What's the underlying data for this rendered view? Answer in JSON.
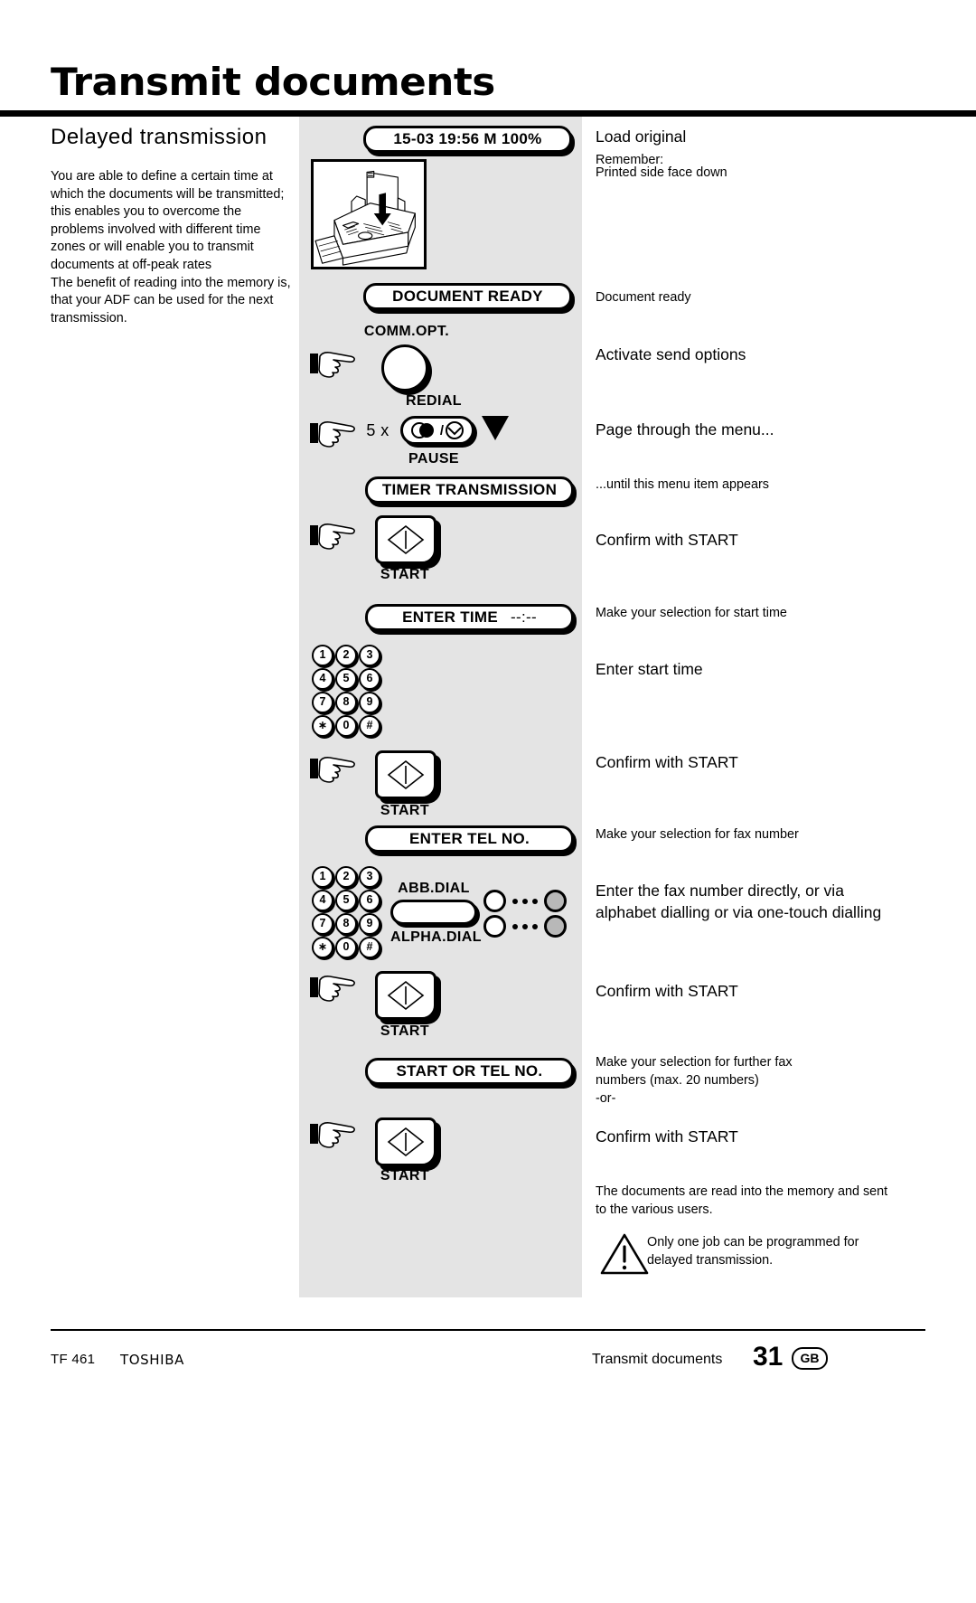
{
  "header": {
    "title": "Transmit documents"
  },
  "left": {
    "section_title": "Delayed transmission",
    "paragraph1": "You are able to define a certain time at which the documents will be transmitted; this enables you to overcome the problems involved with different time zones or will enable you to transmit documents at off-peak rates",
    "paragraph2": "The benefit of reading into the memory is, that your ADF can be used for the next transmission."
  },
  "displays": {
    "standby": "15-03 19:56  M 100%",
    "document_ready": "DOCUMENT READY",
    "timer_transmission": "TIMER TRANSMISSION",
    "enter_time": "ENTER TIME",
    "enter_time_value": "--:--",
    "enter_tel_no": "ENTER TEL NO.",
    "start_or_tel_no": "START OR TEL NO."
  },
  "keys": {
    "comm_opt": "COMM.OPT.",
    "redial": "REDIAL",
    "pause": "PAUSE",
    "start": "START",
    "abb_dial": "ABB.DIAL",
    "alpha_dial": "ALPHA.DIAL",
    "repeat_count": "5 x"
  },
  "keypad": {
    "rows": [
      [
        "1",
        "2",
        "3"
      ],
      [
        "4",
        "5",
        "6"
      ],
      [
        "7",
        "8",
        "9"
      ],
      [
        "∗",
        "0",
        "#"
      ]
    ]
  },
  "right": {
    "load_original_title": "Load original",
    "load_original_line1": "Remember:",
    "load_original_line2": "Printed side face down",
    "document_ready": "Document ready",
    "activate_send_options": "Activate send options",
    "page_through_menu": "Page through the menu...",
    "until_menu_item": "...until this menu item appears",
    "confirm_start_1": "Confirm with START",
    "selection_start_time": "Make your selection for start time",
    "enter_start_time": "Enter start time",
    "confirm_start_2": "Confirm with START",
    "selection_fax_number": "Make your selection for fax number",
    "enter_fax_number": "Enter the fax number directly, or via alphabet dialling or via one-touch dialling",
    "confirm_start_3": "Confirm with START",
    "further_numbers_l1": "Make your selection for further fax",
    "further_numbers_l2": "numbers (max. 20 numbers)",
    "further_numbers_l3": "-or-",
    "confirm_start_4": "Confirm with START",
    "memory_note": "The documents are read into the memory and sent to the various users.",
    "warning": "Only one job can be programmed for delayed transmission."
  },
  "footer": {
    "model": "TF 461",
    "brand": "TOSHIBA",
    "section": "Transmit documents",
    "page_number": "31",
    "language": "GB"
  }
}
